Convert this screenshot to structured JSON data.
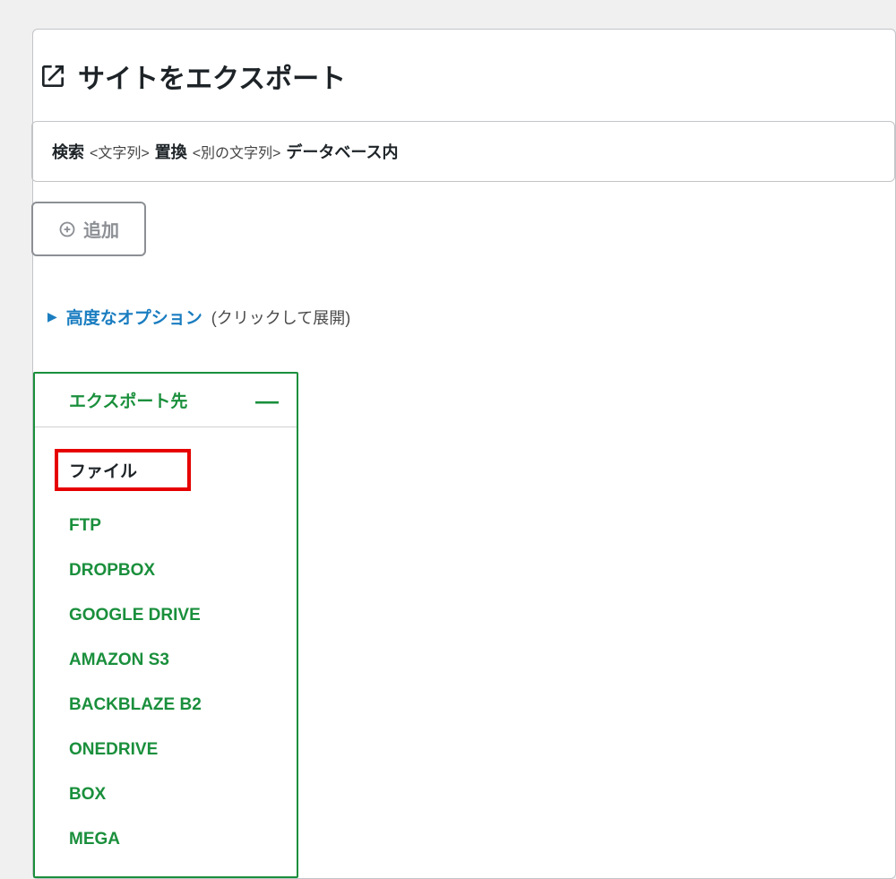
{
  "page": {
    "title": "サイトをエクスポート"
  },
  "search_replace": {
    "search_label": "検索",
    "search_hint": "<文字列>",
    "replace_label": "置換",
    "replace_hint": "<別の文字列>",
    "in_db_label": "データベース内"
  },
  "add_button": {
    "label": "追加"
  },
  "advanced": {
    "label": "高度なオプション",
    "paren": "(クリックして展開)"
  },
  "export_dest": {
    "header": "エクスポート先",
    "collapse_symbol": "—",
    "items": [
      {
        "label": "ファイル",
        "highlighted": true
      },
      {
        "label": "FTP",
        "highlighted": false
      },
      {
        "label": "DROPBOX",
        "highlighted": false
      },
      {
        "label": "GOOGLE DRIVE",
        "highlighted": false
      },
      {
        "label": "AMAZON S3",
        "highlighted": false
      },
      {
        "label": "BACKBLAZE B2",
        "highlighted": false
      },
      {
        "label": "ONEDRIVE",
        "highlighted": false
      },
      {
        "label": "BOX",
        "highlighted": false
      },
      {
        "label": "MEGA",
        "highlighted": false
      }
    ]
  }
}
